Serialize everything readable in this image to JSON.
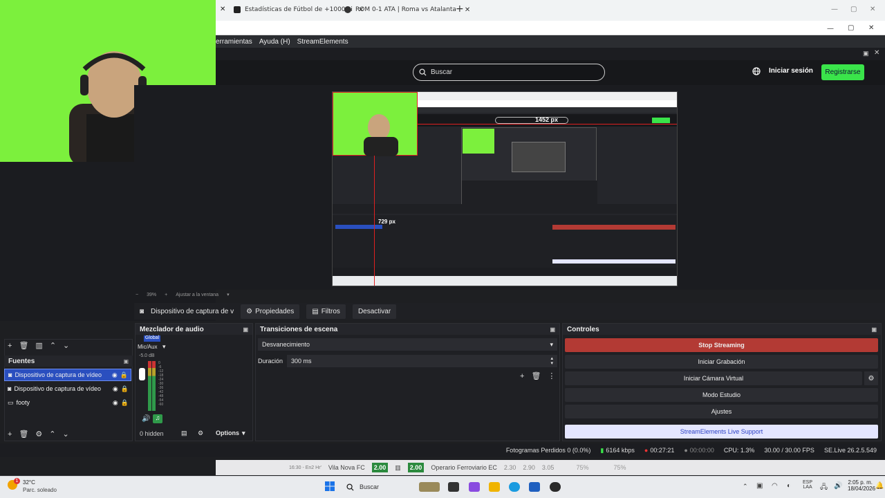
{
  "browser": {
    "tabs": [
      {
        "label": "Estadísticas de Fútbol de +1000 Li"
      },
      {
        "label": "ROM 0-1 ATA | Roma vs Atalanta"
      }
    ],
    "new_tab": "+",
    "close": "✕"
  },
  "menu": {
    "items": [
      "erramientas",
      "Ayuda (H)",
      "StreamElements"
    ]
  },
  "header": {
    "search_placeholder": "Buscar",
    "login": "Iniciar sesión",
    "register": "Registrarse"
  },
  "preview": {
    "width_label": "1452 px",
    "height_label": "729 px",
    "zoom": "39%",
    "fit": "Ajustar a la ventana"
  },
  "source_toolbar": {
    "current": "Dispositivo de captura de v",
    "properties": "Propiedades",
    "filters": "Filtros",
    "deactivate": "Desactivar"
  },
  "sources": {
    "title": "Fuentes",
    "items": [
      {
        "label": "Dispositivo de captura de vídeo",
        "selected": true
      },
      {
        "label": "Dispositivo de captura de vídeo",
        "selected": false
      },
      {
        "label": "footy",
        "selected": false
      }
    ]
  },
  "mixer": {
    "title": "Mezclador de audio",
    "global": "Global",
    "channel": "Mic/Aux",
    "db": "-5.0 dB",
    "scale": [
      "0",
      "-6",
      "-12",
      "-18",
      "-24",
      "-30",
      "-36",
      "-42",
      "-48",
      "-54",
      "-60"
    ],
    "hidden": "0 hidden",
    "options": "Options"
  },
  "transitions": {
    "title": "Transiciones de escena",
    "selected": "Desvanecimiento",
    "duration_label": "Duración",
    "duration_value": "300 ms"
  },
  "controls": {
    "title": "Controles",
    "stop_streaming": "Stop Streaming",
    "start_recording": "Iniciar Grabación",
    "virtual_cam": "Iniciar Cámara Virtual",
    "studio_mode": "Modo Estudio",
    "settings": "Ajustes",
    "live_support": "StreamElements Live Support"
  },
  "status": {
    "dropped": "Fotogramas Perdidos 0 (0.0%)",
    "bitrate": "6164 kbps",
    "live_time": "00:27:21",
    "rec_time": "00:00:00",
    "cpu": "CPU: 1.3%",
    "fps": "30.00 / 30.00 FPS",
    "version": "SE.Live 26.2.5.549"
  },
  "ticker": {
    "time": "16:30 - En2 Hr'",
    "team1": "Vila Nova FC",
    "odd1": "2.00",
    "team2": "Operario Ferroviario EC",
    "odd2": "2.00",
    "o1": "2.30",
    "o2": "2.90",
    "o3": "3.05",
    "p1": "75%",
    "p2": "75%"
  },
  "taskbar": {
    "weather_temp": "32°C",
    "weather_desc": "Parc. soleado",
    "search": "Buscar",
    "lang1": "ESP",
    "lang2": "LAA",
    "time": "2:05 p. m.",
    "date": "18/04/2026",
    "notif": "1"
  },
  "colors": {
    "accent_green": "#3ae44a",
    "stop_red": "#b33a34",
    "selection_blue": "#2a4fbf",
    "chroma_green": "#7cf03d"
  }
}
